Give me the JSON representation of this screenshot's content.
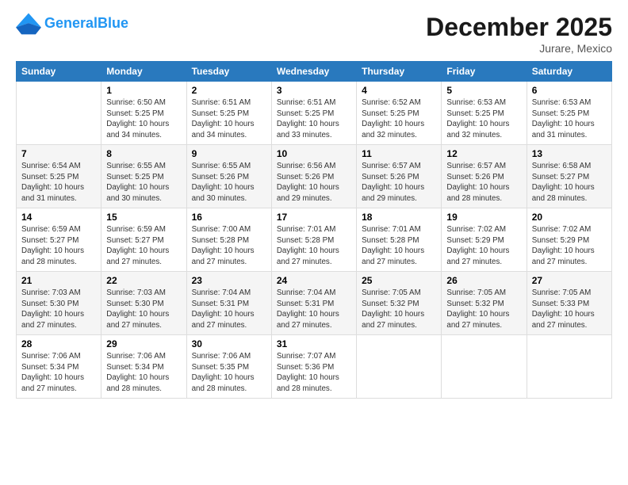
{
  "app": {
    "name": "GeneralBlue",
    "name_part1": "General",
    "name_part2": "Blue"
  },
  "title": "December 2025",
  "location": "Jurare, Mexico",
  "days_of_week": [
    "Sunday",
    "Monday",
    "Tuesday",
    "Wednesday",
    "Thursday",
    "Friday",
    "Saturday"
  ],
  "weeks": [
    [
      {
        "day": "",
        "info": ""
      },
      {
        "day": "1",
        "info": "Sunrise: 6:50 AM\nSunset: 5:25 PM\nDaylight: 10 hours\nand 34 minutes."
      },
      {
        "day": "2",
        "info": "Sunrise: 6:51 AM\nSunset: 5:25 PM\nDaylight: 10 hours\nand 34 minutes."
      },
      {
        "day": "3",
        "info": "Sunrise: 6:51 AM\nSunset: 5:25 PM\nDaylight: 10 hours\nand 33 minutes."
      },
      {
        "day": "4",
        "info": "Sunrise: 6:52 AM\nSunset: 5:25 PM\nDaylight: 10 hours\nand 32 minutes."
      },
      {
        "day": "5",
        "info": "Sunrise: 6:53 AM\nSunset: 5:25 PM\nDaylight: 10 hours\nand 32 minutes."
      },
      {
        "day": "6",
        "info": "Sunrise: 6:53 AM\nSunset: 5:25 PM\nDaylight: 10 hours\nand 31 minutes."
      }
    ],
    [
      {
        "day": "7",
        "info": "Sunrise: 6:54 AM\nSunset: 5:25 PM\nDaylight: 10 hours\nand 31 minutes."
      },
      {
        "day": "8",
        "info": "Sunrise: 6:55 AM\nSunset: 5:25 PM\nDaylight: 10 hours\nand 30 minutes."
      },
      {
        "day": "9",
        "info": "Sunrise: 6:55 AM\nSunset: 5:26 PM\nDaylight: 10 hours\nand 30 minutes."
      },
      {
        "day": "10",
        "info": "Sunrise: 6:56 AM\nSunset: 5:26 PM\nDaylight: 10 hours\nand 29 minutes."
      },
      {
        "day": "11",
        "info": "Sunrise: 6:57 AM\nSunset: 5:26 PM\nDaylight: 10 hours\nand 29 minutes."
      },
      {
        "day": "12",
        "info": "Sunrise: 6:57 AM\nSunset: 5:26 PM\nDaylight: 10 hours\nand 28 minutes."
      },
      {
        "day": "13",
        "info": "Sunrise: 6:58 AM\nSunset: 5:27 PM\nDaylight: 10 hours\nand 28 minutes."
      }
    ],
    [
      {
        "day": "14",
        "info": "Sunrise: 6:59 AM\nSunset: 5:27 PM\nDaylight: 10 hours\nand 28 minutes."
      },
      {
        "day": "15",
        "info": "Sunrise: 6:59 AM\nSunset: 5:27 PM\nDaylight: 10 hours\nand 27 minutes."
      },
      {
        "day": "16",
        "info": "Sunrise: 7:00 AM\nSunset: 5:28 PM\nDaylight: 10 hours\nand 27 minutes."
      },
      {
        "day": "17",
        "info": "Sunrise: 7:01 AM\nSunset: 5:28 PM\nDaylight: 10 hours\nand 27 minutes."
      },
      {
        "day": "18",
        "info": "Sunrise: 7:01 AM\nSunset: 5:28 PM\nDaylight: 10 hours\nand 27 minutes."
      },
      {
        "day": "19",
        "info": "Sunrise: 7:02 AM\nSunset: 5:29 PM\nDaylight: 10 hours\nand 27 minutes."
      },
      {
        "day": "20",
        "info": "Sunrise: 7:02 AM\nSunset: 5:29 PM\nDaylight: 10 hours\nand 27 minutes."
      }
    ],
    [
      {
        "day": "21",
        "info": "Sunrise: 7:03 AM\nSunset: 5:30 PM\nDaylight: 10 hours\nand 27 minutes."
      },
      {
        "day": "22",
        "info": "Sunrise: 7:03 AM\nSunset: 5:30 PM\nDaylight: 10 hours\nand 27 minutes."
      },
      {
        "day": "23",
        "info": "Sunrise: 7:04 AM\nSunset: 5:31 PM\nDaylight: 10 hours\nand 27 minutes."
      },
      {
        "day": "24",
        "info": "Sunrise: 7:04 AM\nSunset: 5:31 PM\nDaylight: 10 hours\nand 27 minutes."
      },
      {
        "day": "25",
        "info": "Sunrise: 7:05 AM\nSunset: 5:32 PM\nDaylight: 10 hours\nand 27 minutes."
      },
      {
        "day": "26",
        "info": "Sunrise: 7:05 AM\nSunset: 5:32 PM\nDaylight: 10 hours\nand 27 minutes."
      },
      {
        "day": "27",
        "info": "Sunrise: 7:05 AM\nSunset: 5:33 PM\nDaylight: 10 hours\nand 27 minutes."
      }
    ],
    [
      {
        "day": "28",
        "info": "Sunrise: 7:06 AM\nSunset: 5:34 PM\nDaylight: 10 hours\nand 27 minutes."
      },
      {
        "day": "29",
        "info": "Sunrise: 7:06 AM\nSunset: 5:34 PM\nDaylight: 10 hours\nand 28 minutes."
      },
      {
        "day": "30",
        "info": "Sunrise: 7:06 AM\nSunset: 5:35 PM\nDaylight: 10 hours\nand 28 minutes."
      },
      {
        "day": "31",
        "info": "Sunrise: 7:07 AM\nSunset: 5:36 PM\nDaylight: 10 hours\nand 28 minutes."
      },
      {
        "day": "",
        "info": ""
      },
      {
        "day": "",
        "info": ""
      },
      {
        "day": "",
        "info": ""
      }
    ]
  ]
}
